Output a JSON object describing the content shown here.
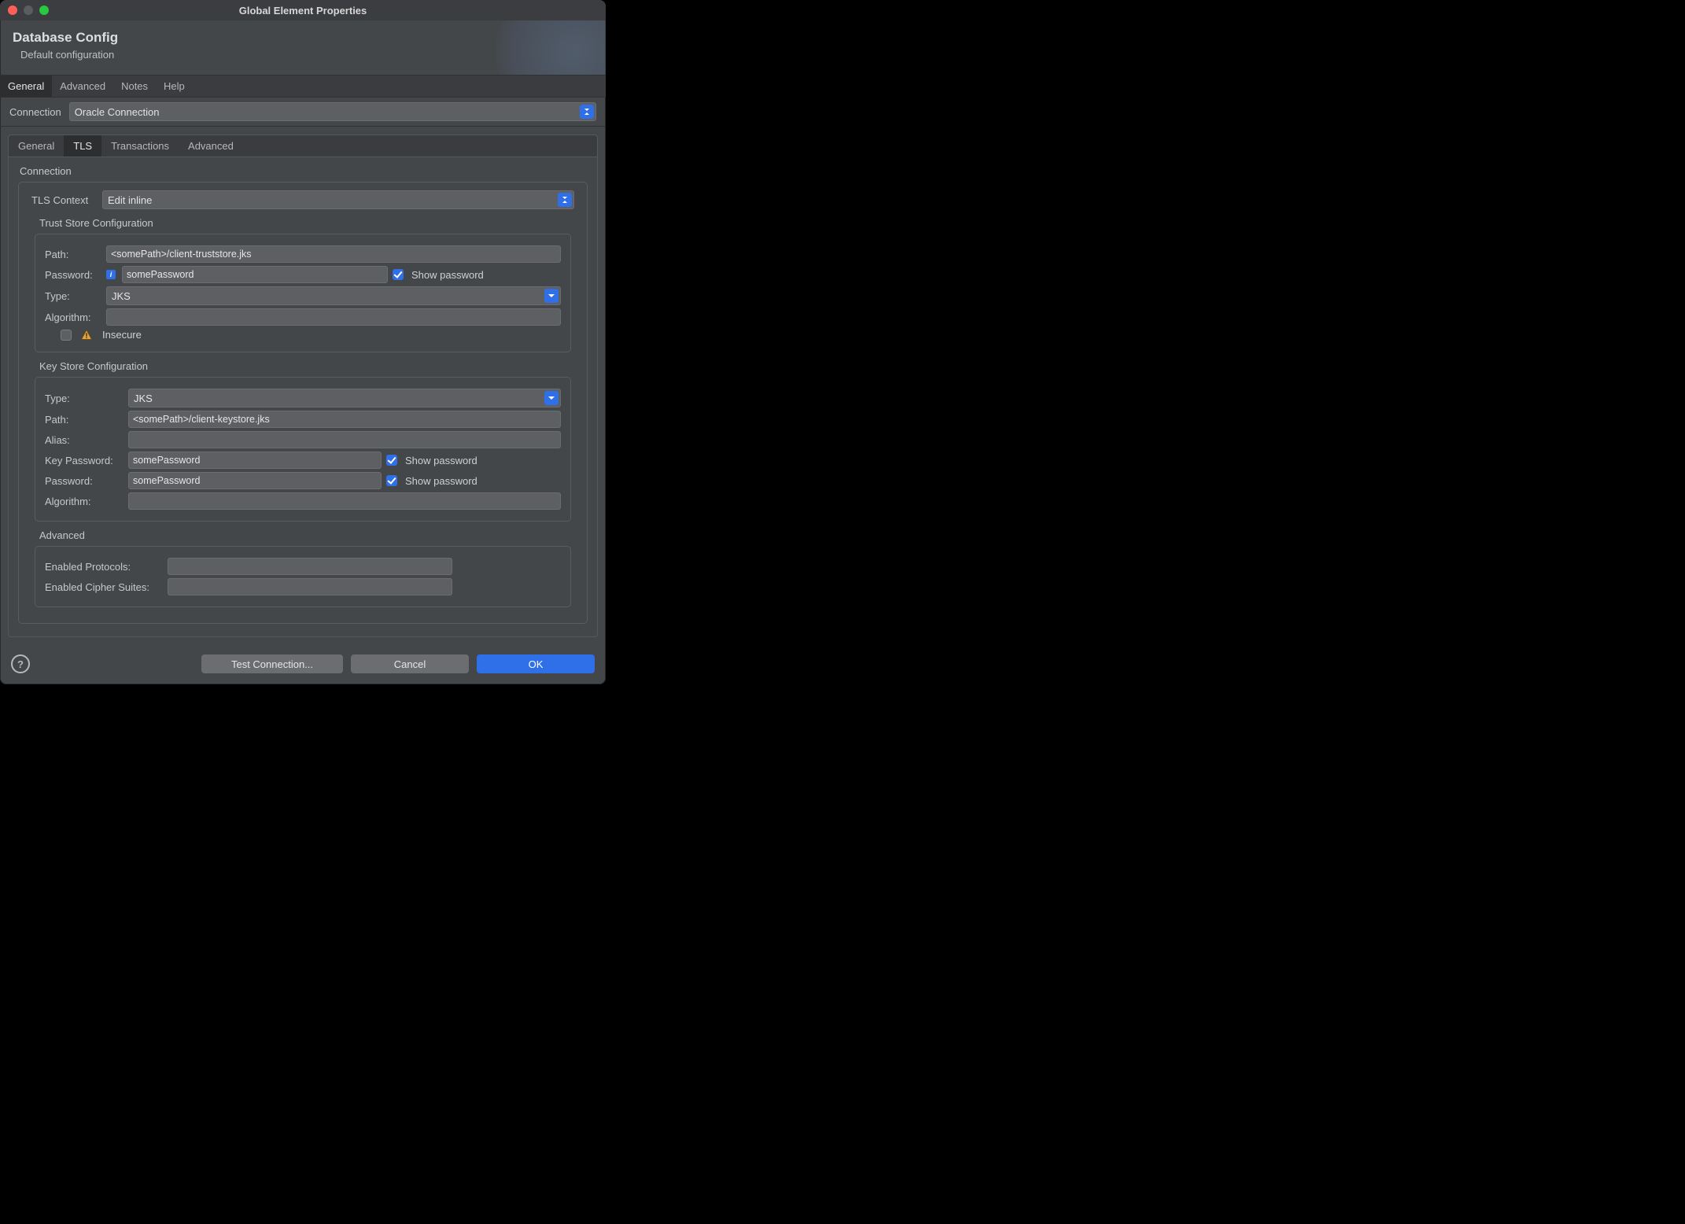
{
  "window": {
    "title": "Global Element Properties"
  },
  "header": {
    "title": "Database Config",
    "subtitle": "Default configuration"
  },
  "topTabs": {
    "general": "General",
    "advanced": "Advanced",
    "notes": "Notes",
    "help": "Help"
  },
  "connection": {
    "label": "Connection",
    "value": "Oracle Connection"
  },
  "innerTabs": {
    "general": "General",
    "tls": "TLS",
    "transactions": "Transactions",
    "advanced": "Advanced"
  },
  "tls": {
    "sectionTitle": "Connection",
    "context": {
      "label": "TLS Context",
      "value": "Edit inline"
    },
    "trustStore": {
      "title": "Trust Store Configuration",
      "pathLabel": "Path:",
      "pathValue": "<somePath>/client-truststore.jks",
      "passwordLabel": "Password:",
      "passwordValue": "somePassword",
      "showPasswordLabel": "Show password",
      "showPasswordChecked": true,
      "typeLabel": "Type:",
      "typeValue": "JKS",
      "algorithmLabel": "Algorithm:",
      "algorithmValue": "",
      "insecureLabel": "Insecure",
      "insecureChecked": false
    },
    "keyStore": {
      "title": "Key Store Configuration",
      "typeLabel": "Type:",
      "typeValue": "JKS",
      "pathLabel": "Path:",
      "pathValue": "<somePath>/client-keystore.jks",
      "aliasLabel": "Alias:",
      "aliasValue": "",
      "keyPasswordLabel": "Key Password:",
      "keyPasswordValue": "somePassword",
      "passwordLabel": "Password:",
      "passwordValue": "somePassword",
      "showPasswordLabel": "Show password",
      "showKeyPasswordChecked": true,
      "showPasswordChecked": true,
      "algorithmLabel": "Algorithm:",
      "algorithmValue": ""
    },
    "advanced": {
      "title": "Advanced",
      "protocolsLabel": "Enabled Protocols:",
      "protocolsValue": "",
      "cipherLabel": "Enabled Cipher Suites:",
      "cipherValue": ""
    }
  },
  "footer": {
    "testConnection": "Test Connection...",
    "cancel": "Cancel",
    "ok": "OK"
  }
}
